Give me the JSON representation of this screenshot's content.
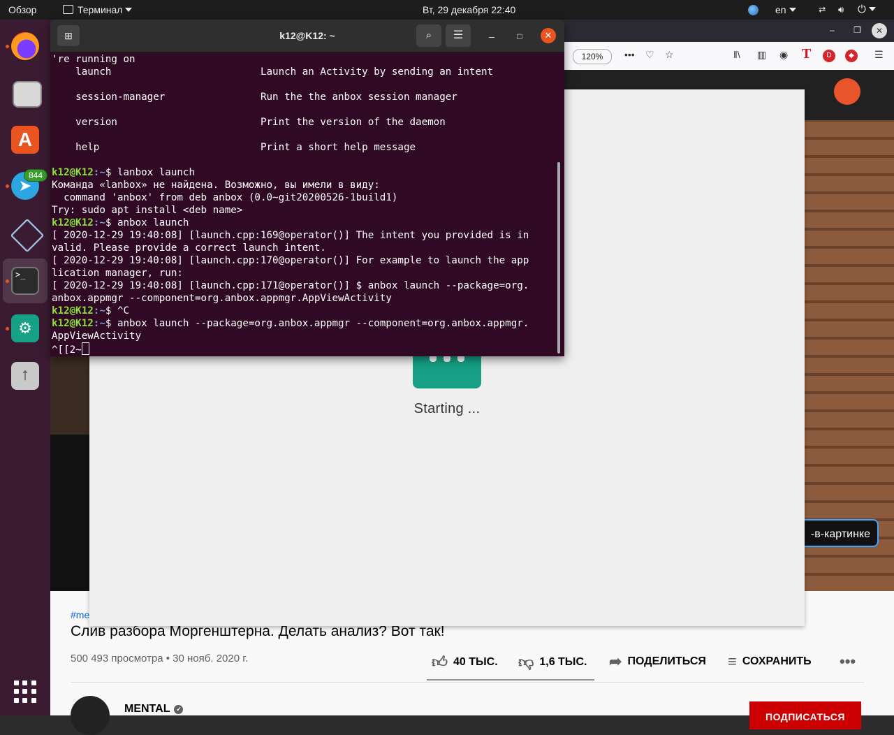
{
  "topbar": {
    "overview": "Обзор",
    "app_menu": "Терминал",
    "clock": "Вт, 29 декабря  22:40",
    "language": "en"
  },
  "dock": {
    "telegram_badge": "844",
    "terminal_glyph": ">_"
  },
  "firefox": {
    "zoom": "120%"
  },
  "terminal": {
    "title": "k12@K12: ~",
    "prompt_user": "k12@K12",
    "prompt_path": ":~",
    "lines": [
      {
        "text": "'re running on"
      },
      {
        "text": "    launch                         Launch an Activity by sending an intent"
      },
      {
        "text": ""
      },
      {
        "text": "    session-manager                Run the the anbox session manager"
      },
      {
        "text": ""
      },
      {
        "text": "    version                        Print the version of the daemon"
      },
      {
        "text": ""
      },
      {
        "text": "    help                           Print a short help message"
      },
      {
        "text": ""
      },
      {
        "cmd": "$ lanbox launch"
      },
      {
        "text": "Команда «lanbox» не найдена. Возможно, вы имели в виду:"
      },
      {
        "text": "  command 'anbox' from deb anbox (0.0~git20200526-1build1)"
      },
      {
        "text": "Try: sudo apt install <deb name>"
      },
      {
        "cmd": "$ anbox launch"
      },
      {
        "text": "[ 2020-12-29 19:40:08] [launch.cpp:169@operator()] The intent you provided is in"
      },
      {
        "text": "valid. Please provide a correct launch intent."
      },
      {
        "text": "[ 2020-12-29 19:40:08] [launch.cpp:170@operator()] For example to launch the app"
      },
      {
        "text": "lication manager, run:"
      },
      {
        "text": "[ 2020-12-29 19:40:08] [launch.cpp:171@operator()] $ anbox launch --package=org."
      },
      {
        "text": "anbox.appmgr --component=org.anbox.appmgr.AppViewActivity"
      },
      {
        "cmd": "$ ^C"
      },
      {
        "cmd": "$ anbox launch --package=org.anbox.appmgr --component=org.anbox.appmgr."
      },
      {
        "text": "AppViewActivity"
      }
    ],
    "current_input": "^[[2~"
  },
  "anbox": {
    "status": "Starting ..."
  },
  "youtube": {
    "hashtag": "#me",
    "title": "Слив разбора Моргенштерна. Делать анализ? Вот так!",
    "meta": "500 493 просмотра • 30 нояб. 2020 г.",
    "likes": "40 ТЫС.",
    "dislikes": "1,6 ТЫС.",
    "share": "ПОДЕЛИТЬСЯ",
    "save": "СОХРАНИТЬ",
    "pip": "-в-картинке",
    "channel": "MENTAL",
    "subscribe": "ПОДПИСАТЬСЯ"
  }
}
